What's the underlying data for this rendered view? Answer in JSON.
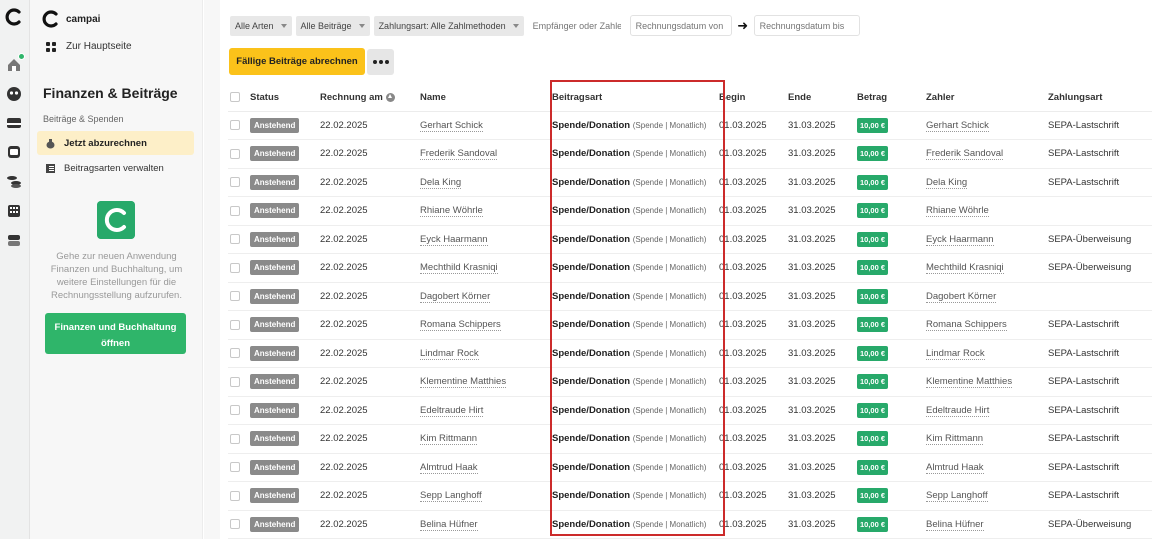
{
  "rail": {
    "icons": [
      "campai-logo",
      "home-icon",
      "people-icon",
      "folder-icon",
      "box-icon",
      "coins-icon",
      "calculator-icon",
      "stack-icon"
    ]
  },
  "sidebar": {
    "brand": "campai",
    "home_link": "Zur Hauptseite",
    "section_title": "Finanzen & Beiträge",
    "section_sub": "Beiträge & Spenden",
    "items": [
      {
        "label": "Jetzt abzurechnen",
        "active": true
      },
      {
        "label": "Beitragsarten verwalten",
        "active": false
      }
    ],
    "promo_text": "Gehe zur neuen Anwendung Finanzen und Buchhaltung, um weitere Einstellungen für die Rechnungsstellung aufzurufen.",
    "promo_button": "Finanzen und Buchhaltung öffnen"
  },
  "filters": {
    "types": "Alle Arten",
    "fees": "Alle Beiträge",
    "payment": "Zahlungsart: Alle Zahlmethoden",
    "recipient_placeholder": "Empfänger oder Zahler",
    "date_from_placeholder": "Rechnungsdatum von",
    "date_to_placeholder": "Rechnungsdatum bis"
  },
  "toolbar": {
    "primary": "Fällige Beiträge abrechnen"
  },
  "table": {
    "headers": {
      "status": "Status",
      "invoice": "Rechnung am",
      "name": "Name",
      "type": "Beitragsart",
      "begin": "Begin",
      "end": "Ende",
      "amount": "Betrag",
      "payer": "Zahler",
      "payment": "Zahlungsart"
    },
    "rows": [
      {
        "status": "Anstehend",
        "date": "22.02.2025",
        "name": "Gerhart Schick",
        "type": "Spende/Donation",
        "type_sub": "(Spende | Monatlich)",
        "begin": "01.03.2025",
        "end": "31.03.2025",
        "amount": "10,00 €",
        "payer": "Gerhart Schick",
        "payment": "SEPA-Lastschrift"
      },
      {
        "status": "Anstehend",
        "date": "22.02.2025",
        "name": "Frederik Sandoval",
        "type": "Spende/Donation",
        "type_sub": "(Spende | Monatlich)",
        "begin": "01.03.2025",
        "end": "31.03.2025",
        "amount": "10,00 €",
        "payer": "Frederik Sandoval",
        "payment": "SEPA-Lastschrift"
      },
      {
        "status": "Anstehend",
        "date": "22.02.2025",
        "name": "Dela King",
        "type": "Spende/Donation",
        "type_sub": "(Spende | Monatlich)",
        "begin": "01.03.2025",
        "end": "31.03.2025",
        "amount": "10,00 €",
        "payer": "Dela King",
        "payment": "SEPA-Lastschrift"
      },
      {
        "status": "Anstehend",
        "date": "22.02.2025",
        "name": "Rhiane Wöhrle",
        "type": "Spende/Donation",
        "type_sub": "(Spende | Monatlich)",
        "begin": "01.03.2025",
        "end": "31.03.2025",
        "amount": "10,00 €",
        "payer": "Rhiane Wöhrle",
        "payment": ""
      },
      {
        "status": "Anstehend",
        "date": "22.02.2025",
        "name": "Eyck Haarmann",
        "type": "Spende/Donation",
        "type_sub": "(Spende | Monatlich)",
        "begin": "01.03.2025",
        "end": "31.03.2025",
        "amount": "10,00 €",
        "payer": "Eyck Haarmann",
        "payment": "SEPA-Überweisung"
      },
      {
        "status": "Anstehend",
        "date": "22.02.2025",
        "name": "Mechthild Krasniqi",
        "type": "Spende/Donation",
        "type_sub": "(Spende | Monatlich)",
        "begin": "01.03.2025",
        "end": "31.03.2025",
        "amount": "10,00 €",
        "payer": "Mechthild Krasniqi",
        "payment": "SEPA-Überweisung"
      },
      {
        "status": "Anstehend",
        "date": "22.02.2025",
        "name": "Dagobert Körner",
        "type": "Spende/Donation",
        "type_sub": "(Spende | Monatlich)",
        "begin": "01.03.2025",
        "end": "31.03.2025",
        "amount": "10,00 €",
        "payer": "Dagobert Körner",
        "payment": ""
      },
      {
        "status": "Anstehend",
        "date": "22.02.2025",
        "name": "Romana Schippers",
        "type": "Spende/Donation",
        "type_sub": "(Spende | Monatlich)",
        "begin": "01.03.2025",
        "end": "31.03.2025",
        "amount": "10,00 €",
        "payer": "Romana Schippers",
        "payment": "SEPA-Lastschrift"
      },
      {
        "status": "Anstehend",
        "date": "22.02.2025",
        "name": "Lindmar Rock",
        "type": "Spende/Donation",
        "type_sub": "(Spende | Monatlich)",
        "begin": "01.03.2025",
        "end": "31.03.2025",
        "amount": "10,00 €",
        "payer": "Lindmar Rock",
        "payment": "SEPA-Lastschrift"
      },
      {
        "status": "Anstehend",
        "date": "22.02.2025",
        "name": "Klementine Matthies",
        "type": "Spende/Donation",
        "type_sub": "(Spende | Monatlich)",
        "begin": "01.03.2025",
        "end": "31.03.2025",
        "amount": "10,00 €",
        "payer": "Klementine Matthies",
        "payment": "SEPA-Lastschrift"
      },
      {
        "status": "Anstehend",
        "date": "22.02.2025",
        "name": "Edeltraude Hirt",
        "type": "Spende/Donation",
        "type_sub": "(Spende | Monatlich)",
        "begin": "01.03.2025",
        "end": "31.03.2025",
        "amount": "10,00 €",
        "payer": "Edeltraude Hirt",
        "payment": "SEPA-Lastschrift"
      },
      {
        "status": "Anstehend",
        "date": "22.02.2025",
        "name": "Kim Rittmann",
        "type": "Spende/Donation",
        "type_sub": "(Spende | Monatlich)",
        "begin": "01.03.2025",
        "end": "31.03.2025",
        "amount": "10,00 €",
        "payer": "Kim Rittmann",
        "payment": "SEPA-Lastschrift"
      },
      {
        "status": "Anstehend",
        "date": "22.02.2025",
        "name": "Almtrud Haak",
        "type": "Spende/Donation",
        "type_sub": "(Spende | Monatlich)",
        "begin": "01.03.2025",
        "end": "31.03.2025",
        "amount": "10,00 €",
        "payer": "Almtrud Haak",
        "payment": "SEPA-Lastschrift"
      },
      {
        "status": "Anstehend",
        "date": "22.02.2025",
        "name": "Sepp Langhoff",
        "type": "Spende/Donation",
        "type_sub": "(Spende | Monatlich)",
        "begin": "01.03.2025",
        "end": "31.03.2025",
        "amount": "10,00 €",
        "payer": "Sepp Langhoff",
        "payment": "SEPA-Lastschrift"
      },
      {
        "status": "Anstehend",
        "date": "22.02.2025",
        "name": "Belina Hüfner",
        "type": "Spende/Donation",
        "type_sub": "(Spende | Monatlich)",
        "begin": "01.03.2025",
        "end": "31.03.2025",
        "amount": "10,00 €",
        "payer": "Belina Hüfner",
        "payment": "SEPA-Überweisung"
      }
    ]
  },
  "colors": {
    "accent_yellow": "#fbc21a",
    "brand_green": "#2fb56a",
    "highlight_red": "#cc2b2b"
  }
}
